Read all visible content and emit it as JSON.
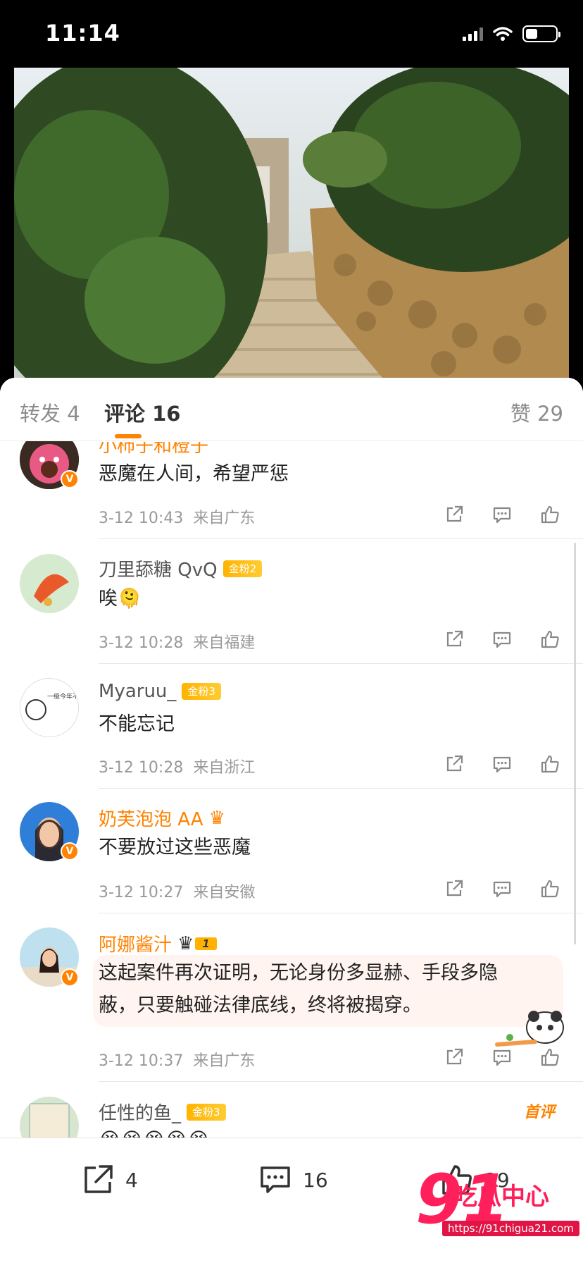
{
  "status_bar": {
    "time": "11:14",
    "battery_level": 0.4
  },
  "tabs": {
    "repost": "转发 4",
    "comments": "评论 16",
    "likes": "赞 29"
  },
  "comments": [
    {
      "name": "小柿子和橙子",
      "text": "恶魔在人间，希望严惩",
      "time": "3-12 10:43",
      "location": "来自广东",
      "badge": ""
    },
    {
      "name": "刀里舔糖 QvQ",
      "text": "唉🫠",
      "time": "3-12 10:28",
      "location": "来自福建",
      "badge": "金粉2"
    },
    {
      "name": "Myaruu_",
      "text": "不能忘记",
      "time": "3-12 10:28",
      "location": "来自浙江",
      "badge": "金粉3"
    },
    {
      "name": "奶芙泡泡 AA",
      "text": "不要放过这些恶魔",
      "time": "3-12 10:27",
      "location": "来自安徽",
      "badge": ""
    },
    {
      "name": "阿娜酱汁",
      "text_line1": "这起案件再次证明，无论身份多显赫、手段多隐",
      "text_line2": "蔽，只要触碰法律底线，终将被揭穿。",
      "time": "3-12 10:37",
      "location": "来自广东",
      "badge": ""
    },
    {
      "name": "任性的鱼_",
      "badge": "金粉3",
      "tag": "首评",
      "text": "😭😭😭😭😭"
    }
  ],
  "avatar_text": "一级今年不用工作也能混口饭吃……",
  "vip_rank": "1",
  "bottom_bar": {
    "repost_count": "4",
    "comment_count": "16",
    "like_count": "29"
  },
  "watermark": {
    "logo_number": "91",
    "logo_text": "吃瓜中心",
    "url": "https://91chigua21.com"
  },
  "colors": {
    "accent": "#ff8200",
    "badge_gold": "#ffb300",
    "watermark": "#ff1f5a"
  }
}
